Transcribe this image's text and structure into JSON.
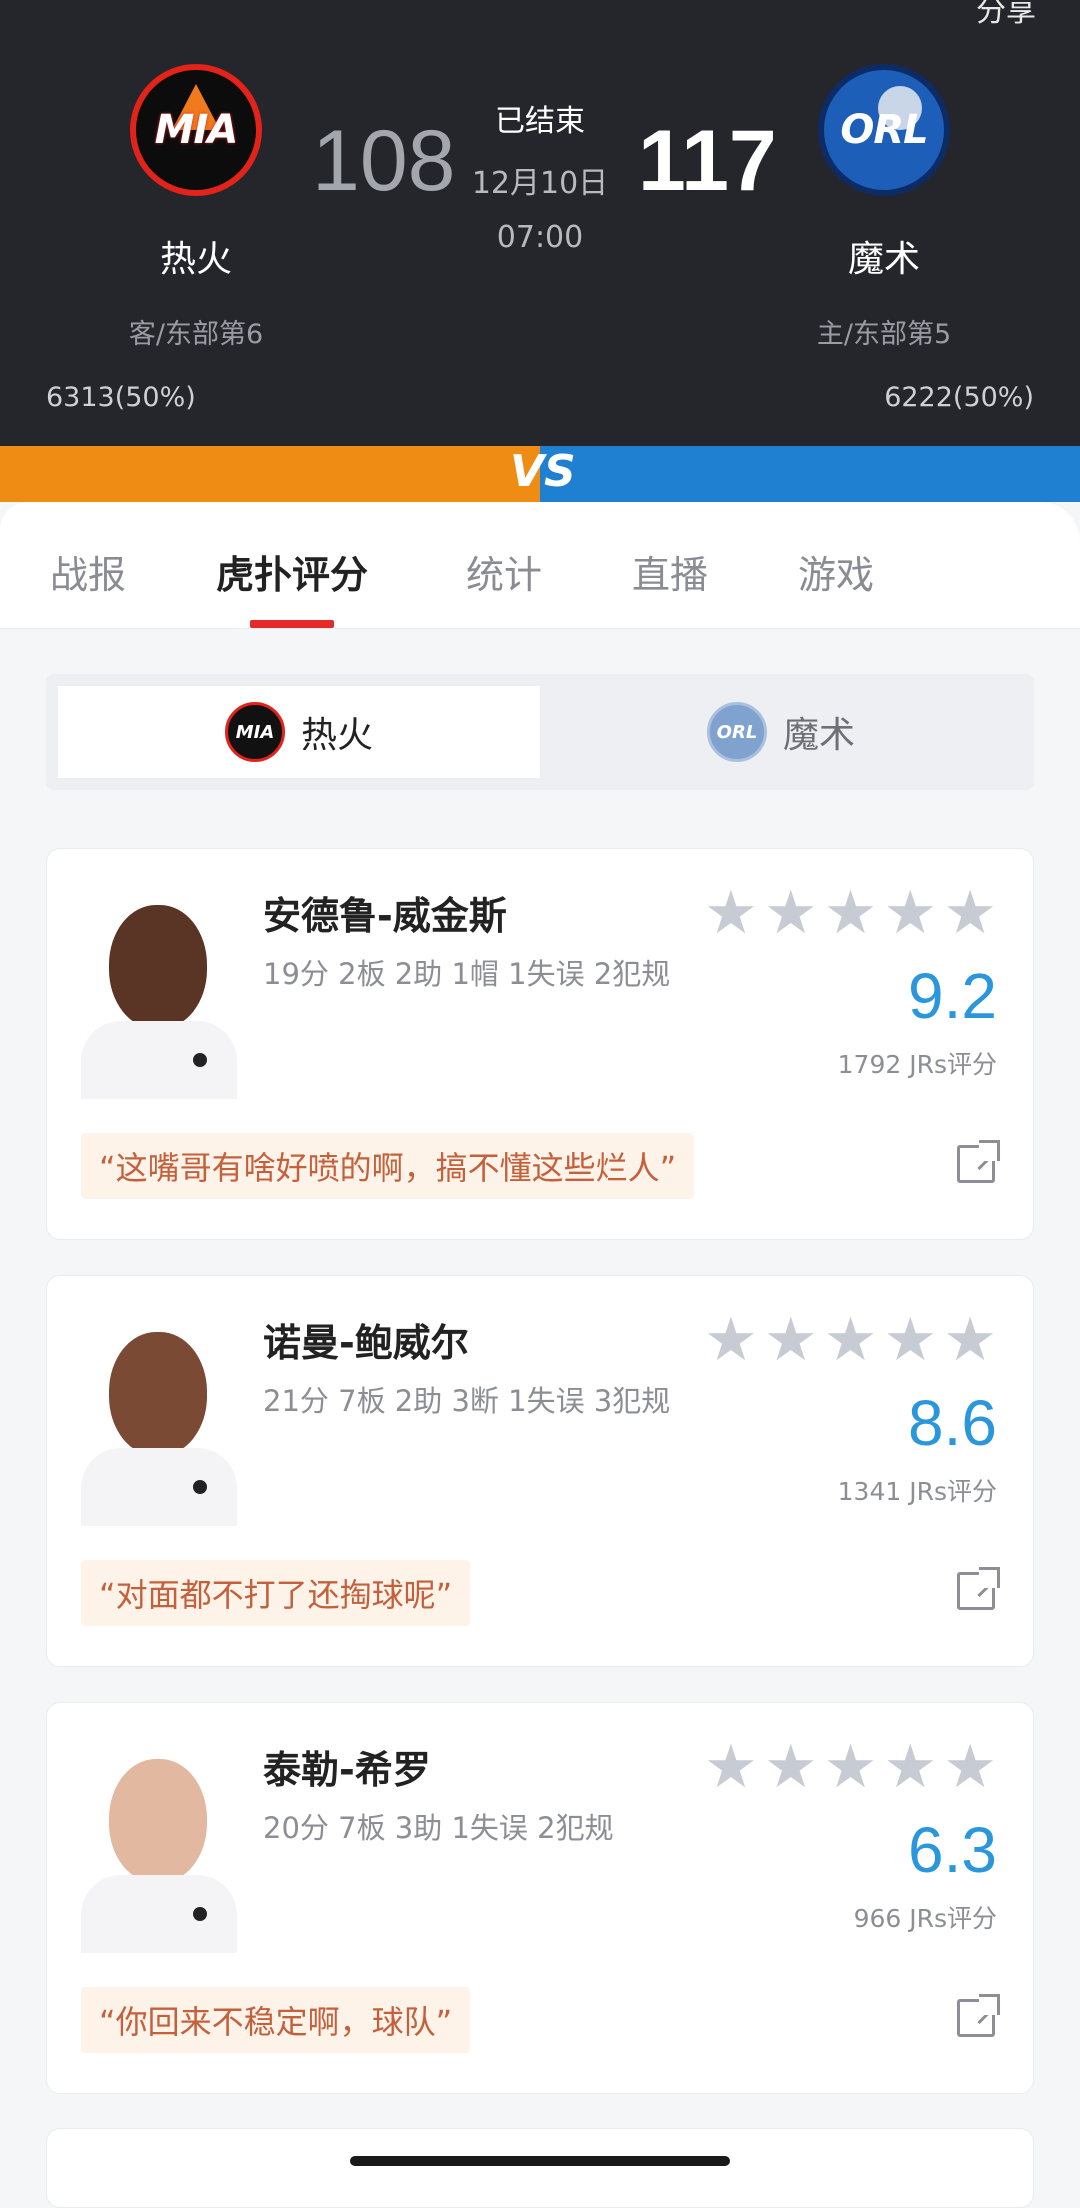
{
  "header": {
    "share_label": "分享",
    "away": {
      "abbr": "MIA",
      "name": "热火",
      "rank": "客/东部第6",
      "score": "108",
      "support": "6313(50%)"
    },
    "home": {
      "abbr": "ORL",
      "name": "魔术",
      "rank": "主/东部第5",
      "score": "117",
      "support": "6222(50%)"
    },
    "status": "已结束",
    "date": "12月10日",
    "time": "07:00",
    "vs": "VS"
  },
  "tabs": [
    {
      "label": "战报"
    },
    {
      "label": "虎扑评分",
      "active": true
    },
    {
      "label": "统计"
    },
    {
      "label": "直播"
    },
    {
      "label": "游戏"
    }
  ],
  "team_switch": {
    "mia": {
      "label": "热火",
      "logo": "MIA",
      "selected": true
    },
    "orl": {
      "label": "魔术",
      "logo": "ORL",
      "selected": false
    }
  },
  "players": [
    {
      "name": "安德鲁-威金斯",
      "stats": "19分 2板 2助 1帽 1失误 2犯规",
      "rating": "9.2",
      "votes": "1792 JRs评分",
      "quote": "“这嘴哥有啥好喷的啊，搞不懂这些烂人”",
      "stars_filled": 0,
      "stars_total": 5
    },
    {
      "name": "诺曼-鲍威尔",
      "stats": "21分 7板 2助 3断 1失误 3犯规",
      "rating": "8.6",
      "votes": "1341 JRs评分",
      "quote": "“对面都不打了还掏球呢”",
      "stars_filled": 0,
      "stars_total": 5
    },
    {
      "name": "泰勒-希罗",
      "stats": "20分 7板 3助 1失误 2犯规",
      "rating": "6.3",
      "votes": "966 JRs评分",
      "quote": "“你回来不稳定啊，球队”",
      "stars_filled": 0,
      "stars_total": 5
    }
  ],
  "colors": {
    "accent_orange": "#ef8c14",
    "accent_blue": "#1f7fd0",
    "rating_blue": "#2a96dc",
    "tab_indicator": "#e52a2a",
    "quote_text": "#c4613c"
  }
}
